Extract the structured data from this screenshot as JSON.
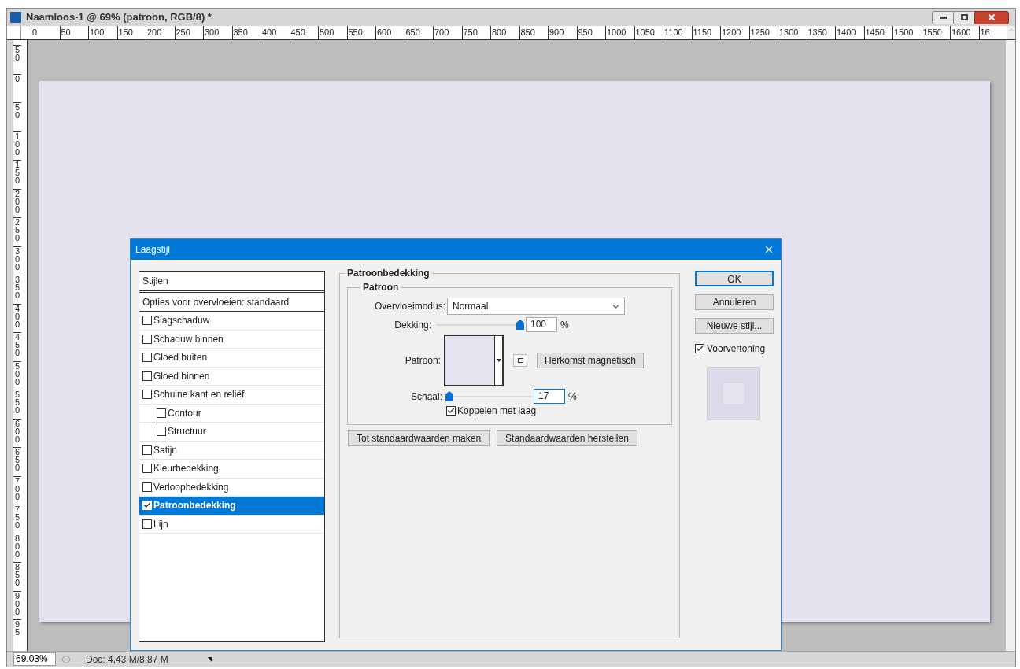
{
  "window": {
    "title": "Naamloos-1 @ 69% (patroon, RGB/8) *"
  },
  "rulers": {
    "horizontal": [
      "0",
      "50",
      "100",
      "150",
      "200",
      "250",
      "300",
      "350",
      "400",
      "450",
      "500",
      "550",
      "600",
      "650",
      "700",
      "750",
      "800",
      "850",
      "900",
      "950",
      "1000",
      "1050",
      "1100",
      "1150",
      "1200",
      "1250",
      "1300",
      "1350",
      "1400",
      "1450",
      "1500",
      "1550",
      "1600",
      "16"
    ],
    "vertical": [
      "50",
      "0",
      "50",
      "100",
      "150",
      "200",
      "250",
      "300",
      "350",
      "400",
      "450",
      "500",
      "550",
      "600",
      "650",
      "700",
      "750",
      "800",
      "850",
      "900",
      "95"
    ]
  },
  "dialog": {
    "title": "Laagstijl",
    "styles_header": "Stijlen",
    "blending_options": "Opties voor overvloeien: standaard",
    "styles": [
      {
        "label": "Slagschaduw",
        "checked": false,
        "selected": false
      },
      {
        "label": "Schaduw binnen",
        "checked": false,
        "selected": false
      },
      {
        "label": "Gloed buiten",
        "checked": false,
        "selected": false
      },
      {
        "label": "Gloed binnen",
        "checked": false,
        "selected": false
      },
      {
        "label": "Schuine kant en reliëf",
        "checked": false,
        "selected": false,
        "children": [
          {
            "label": "Contour",
            "checked": false,
            "selected": false
          },
          {
            "label": "Structuur",
            "checked": false,
            "selected": false
          }
        ]
      },
      {
        "label": "Satijn",
        "checked": false,
        "selected": false
      },
      {
        "label": "Kleurbedekking",
        "checked": false,
        "selected": false
      },
      {
        "label": "Verloopbedekking",
        "checked": false,
        "selected": false
      },
      {
        "label": "Patroonbedekking",
        "checked": true,
        "selected": true
      },
      {
        "label": "Lijn",
        "checked": false,
        "selected": false
      }
    ],
    "section": {
      "title": "Patroonbedekking",
      "group_title": "Patroon",
      "blend_mode": {
        "label": "Overvloeimodus:",
        "value": "Normaal"
      },
      "opacity": {
        "label": "Dekking:",
        "level": 1,
        "value": "100",
        "unit": "%"
      },
      "pattern_label": "Patroon:",
      "snap_button": "Herkomst magnetisch",
      "scale": {
        "label": "Schaal:",
        "level": 0.02,
        "value": "17",
        "unit": "%"
      },
      "link": {
        "label": "Koppelen met laag",
        "checked": true
      },
      "buttons": [
        "Tot standaardwaarden maken",
        "Standaardwaarden herstellen"
      ]
    },
    "actions": [
      {
        "label": "OK",
        "default": true
      },
      {
        "label": "Annuleren",
        "default": false
      },
      {
        "label": "Nieuwe stijl...",
        "default": false
      }
    ],
    "preview": {
      "label": "Voorvertoning",
      "checked": true
    }
  },
  "status_bar": {
    "zoom": "69.03%",
    "doc_info": "Doc: 4,43 M/8,87 M"
  }
}
